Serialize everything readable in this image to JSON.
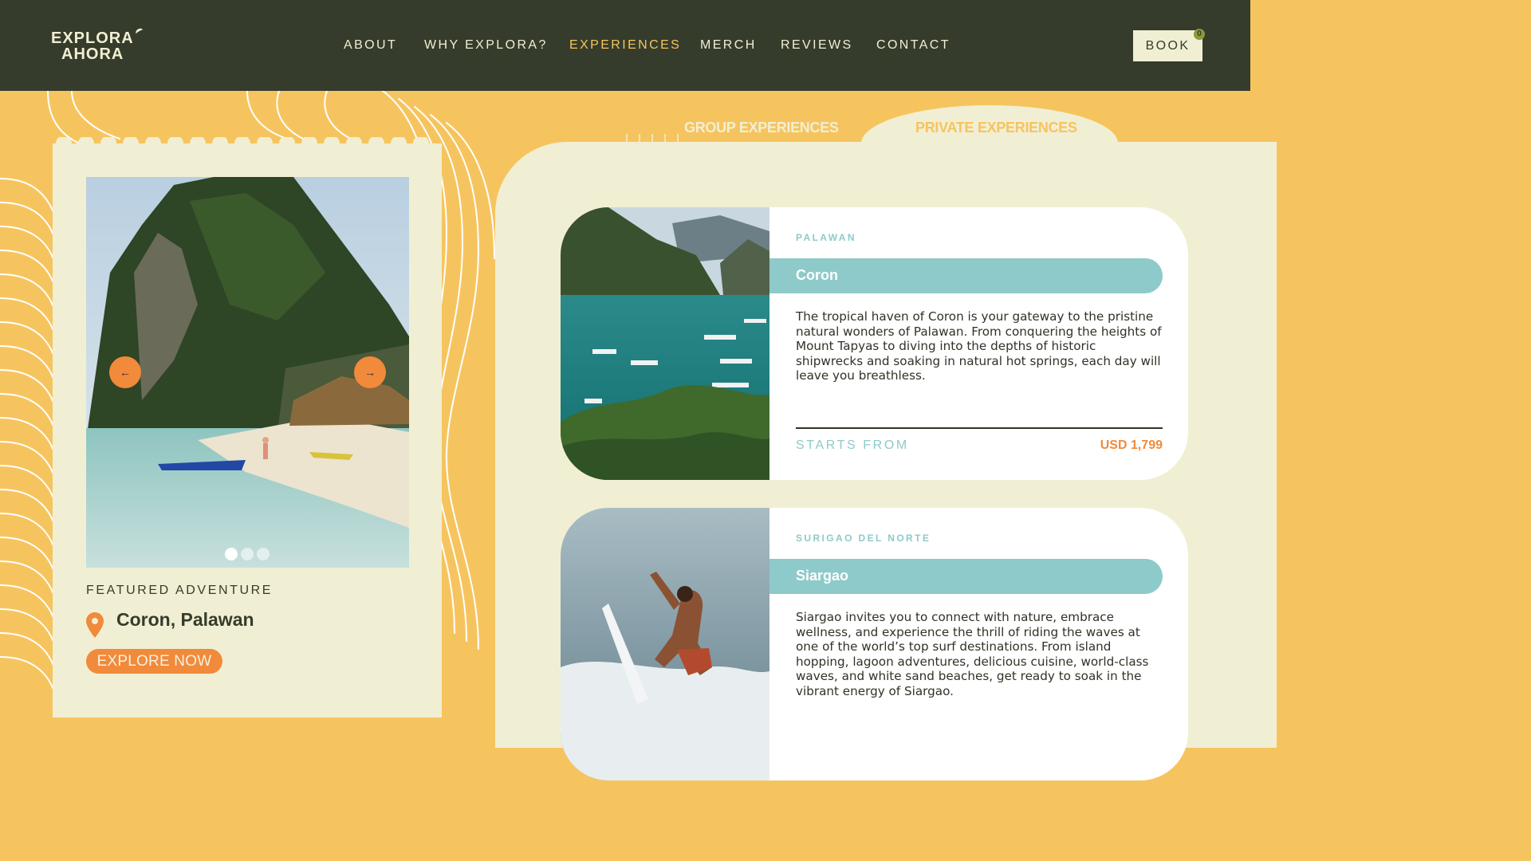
{
  "brand": {
    "line1": "EXPLORA",
    "line2": "AHORA"
  },
  "nav": [
    {
      "label": "ABOUT",
      "active": false
    },
    {
      "label": "WHY EXPLORA?",
      "active": false
    },
    {
      "label": "EXPERIENCES",
      "active": true
    },
    {
      "label": "MERCH",
      "active": false
    },
    {
      "label": "REVIEWS",
      "active": false
    },
    {
      "label": "CONTACT",
      "active": false
    }
  ],
  "book": {
    "label": "BOOK",
    "cart_count": "0"
  },
  "featured": {
    "label": "FEATURED ADVENTURE",
    "place": "Coron, Palawan",
    "cta": "EXPLORE NOW",
    "prev_icon": "arrow-left-icon",
    "next_icon": "arrow-right-icon",
    "slides": 3,
    "active_slide": 1
  },
  "tabs": {
    "group": "GROUP EXPERIENCES",
    "private": "PRIVATE EXPERIENCES",
    "selected": "private"
  },
  "experiences": [
    {
      "region": "PALAWAN",
      "name": "Coron",
      "description": "The tropical haven of Coron is your gateway to the pristine natural wonders of Palawan. From conquering the heights of Mount Tapyas to diving into the depths of historic shipwrecks and soaking in natural hot springs, each day will leave you breathless.",
      "starts_label": "STARTS FROM",
      "price": "USD 1,799"
    },
    {
      "region": "SURIGAO DEL NORTE",
      "name": "Siargao",
      "description": "Siargao invites you to connect with nature, embrace wellness, and experience the thrill of riding the waves at one of the world’s top surf destinations. From island hopping, lagoon adventures, delicious cuisine, world-class waves, and white sand beaches, get ready to soak in the vibrant energy of Siargao."
    }
  ],
  "colors": {
    "header_bg": "#353c2b",
    "cream": "#f1efd3",
    "yellow": "#f6c45f",
    "orange": "#f18a3b",
    "teal": "#8ecaca"
  }
}
